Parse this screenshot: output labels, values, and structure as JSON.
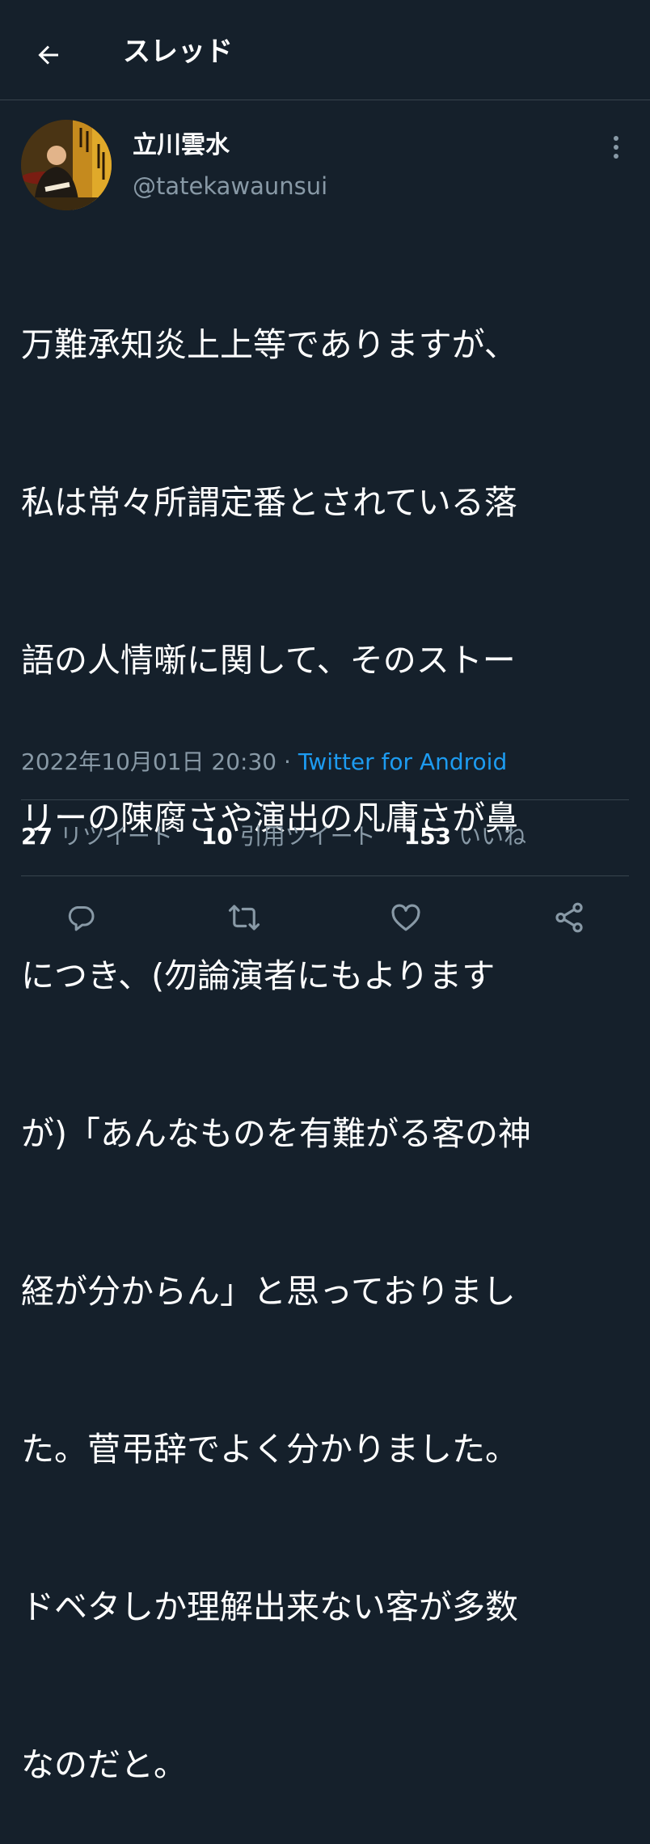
{
  "header": {
    "title": "スレッド",
    "back_icon": "arrow-left-icon"
  },
  "author": {
    "name": "立川雲水",
    "handle": "@tatekawaunsui"
  },
  "tweet": {
    "lines": [
      "万難承知炎上上等でありますが、",
      "私は常々所謂定番とされている落",
      "語の人情噺に関して、そのストー",
      "リーの陳腐さや演出の凡庸さが鼻",
      "につき、(勿論演者にもよります",
      "が)「あんなものを有難がる客の神",
      "経が分からん」と思っておりまし",
      "た。菅弔辞でよく分かりました。",
      "ドベタしか理解出来ない客が多数",
      "なのだと。"
    ],
    "timestamp": "2022年10月01日 20:30",
    "separator": "·",
    "source": "Twitter for Android"
  },
  "stats": {
    "retweets": {
      "count": "27",
      "label": "リツイート"
    },
    "quotes": {
      "count": "10",
      "label": "引用ツイート"
    },
    "likes": {
      "count": "153",
      "label": "いいね"
    }
  },
  "actions": [
    "reply-icon",
    "retweet-icon",
    "like-icon",
    "share-icon"
  ],
  "colors": {
    "background": "#15202b",
    "text": "#ffffff",
    "secondary": "#8899a6",
    "accent": "#1d9bf0",
    "border": "#38444d"
  }
}
